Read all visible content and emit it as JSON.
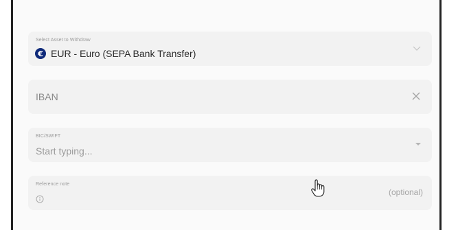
{
  "asset_field": {
    "label": "Select Asset to Withdraw",
    "selected_value": "EUR - Euro (SEPA Bank Transfer)",
    "currency_symbol": "€"
  },
  "iban_field": {
    "value": "IBAN"
  },
  "bic_field": {
    "label": "BIC/SWIFT",
    "placeholder": "Start typing..."
  },
  "reference_field": {
    "label": "Reference note",
    "optional_text": "(optional)"
  },
  "colors": {
    "euro_badge": "#0f2a7a",
    "field_background": "#f2f2f2"
  },
  "icons": [
    "euro-icon",
    "chevron-down-icon",
    "close-icon",
    "dropdown-arrow-icon",
    "info-icon",
    "hand-pointer-cursor-icon"
  ]
}
